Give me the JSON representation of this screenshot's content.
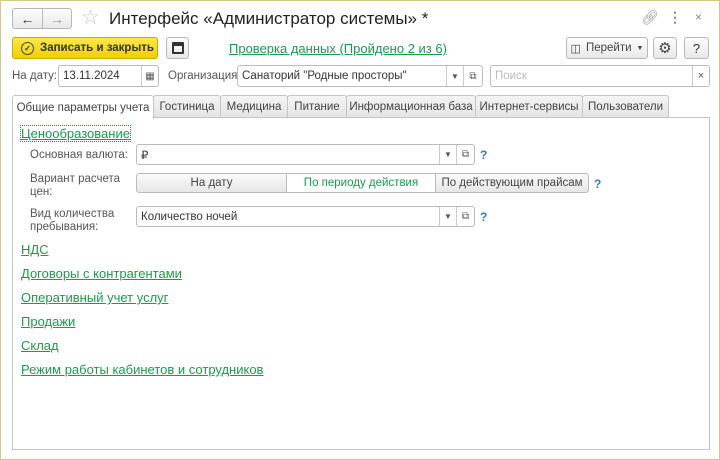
{
  "window": {
    "title": "Интерфейс «Администратор системы» *"
  },
  "toolbar": {
    "save_close": "Записать и закрыть",
    "check_link": "Проверка данных (Пройдено 2 из 6)",
    "goto": "Перейти",
    "help": "?"
  },
  "filters": {
    "date_label": "На дату:",
    "date_value": "13.11.2024",
    "org_label": "Организация:",
    "org_value": "Санаторий \"Родные просторы\"",
    "search_placeholder": "Поиск"
  },
  "tabs": [
    "Общие параметры учета",
    "Гостиница",
    "Медицина",
    "Питание",
    "Информационная база",
    "Интернет-сервисы",
    "Пользователи"
  ],
  "pricing": {
    "header": "Ценообразование",
    "currency_label": "Основная валюта:",
    "currency_value": "₽",
    "variant_label": "Вариант расчета цен:",
    "variants": [
      "На дату",
      "По периоду действия",
      "По действующим прайсам"
    ],
    "selected_variant": 1,
    "qty_label": "Вид количества пребывания:",
    "qty_value": "Количество ночей",
    "help": "?"
  },
  "sections": [
    "НДС",
    "Договоры с контрагентами",
    "Оперативный учет услуг",
    "Продажи",
    "Склад",
    "Режим работы кабинетов и сотрудников"
  ]
}
